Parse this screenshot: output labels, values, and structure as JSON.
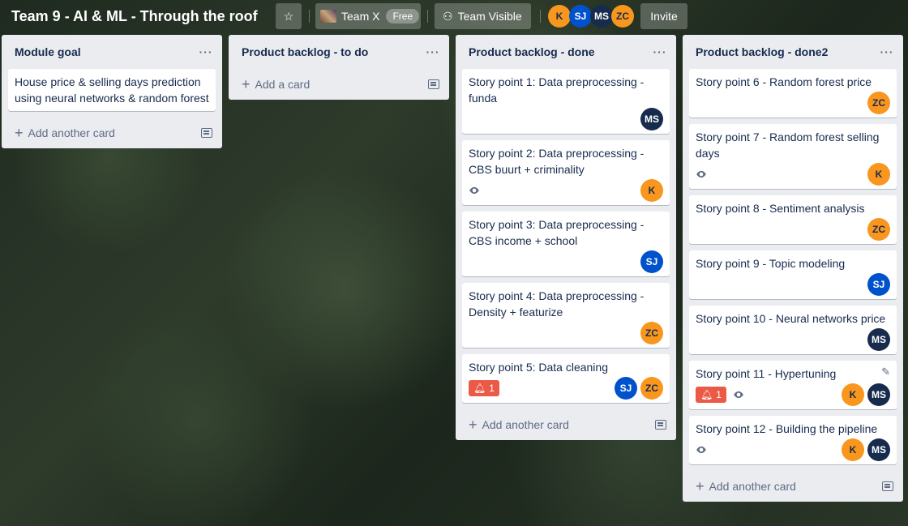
{
  "board": {
    "title": "Team 9 - AI & ML - Through the roof",
    "team_name": "Team X",
    "team_plan": "Free",
    "visibility": "Team Visible",
    "invite_label": "Invite",
    "members": [
      "K",
      "SJ",
      "MS",
      "ZC"
    ]
  },
  "lists": [
    {
      "title": "Module goal",
      "cards": [
        {
          "title": "House price & selling days prediction using neural networks & random forest"
        }
      ],
      "add_label": "Add another card"
    },
    {
      "title": "Product backlog - to do",
      "cards": [],
      "add_label": "Add a card"
    },
    {
      "title": "Product backlog - done",
      "cards": [
        {
          "title": "Story point 1: Data preprocessing - funda",
          "members": [
            "MS"
          ]
        },
        {
          "title": "Story point 2: Data preprocessing - CBS buurt + criminality",
          "members": [
            "K"
          ],
          "watched": true
        },
        {
          "title": "Story point 3: Data preprocessing - CBS income + school",
          "members": [
            "SJ"
          ]
        },
        {
          "title": "Story point 4: Data preprocessing - Density + featurize",
          "members": [
            "ZC"
          ]
        },
        {
          "title": "Story point 5: Data cleaning",
          "members": [
            "SJ",
            "ZC"
          ],
          "alert_count": "1"
        }
      ],
      "add_label": "Add another card"
    },
    {
      "title": "Product backlog - done2",
      "cards": [
        {
          "title": "Story point 6 - Random forest price",
          "members": [
            "ZC"
          ]
        },
        {
          "title": "Story point 7 - Random forest selling days",
          "members": [
            "K"
          ],
          "watched": true
        },
        {
          "title": "Story point 8 - Sentiment analysis",
          "members": [
            "ZC"
          ]
        },
        {
          "title": "Story point 9 - Topic modeling",
          "members": [
            "SJ"
          ]
        },
        {
          "title": "Story point 10 - Neural networks price",
          "members": [
            "MS"
          ]
        },
        {
          "title": "Story point 11 - Hypertuning",
          "members": [
            "K",
            "MS"
          ],
          "alert_count": "1",
          "watched": true
        },
        {
          "title": "Story point 12 - Building the pipeline",
          "members": [
            "K",
            "MS"
          ],
          "watched": true
        }
      ],
      "add_label": "Add another card"
    }
  ],
  "colors": {
    "K": "#f8961e",
    "ZC": "#f8961e",
    "SJ": "#0052cc",
    "MS": "#172b4d",
    "alert": "#eb5a46",
    "list_bg": "#ebecf0"
  },
  "icons": {
    "star": "star-icon",
    "visibility": "team-icon",
    "watch": "eye-icon",
    "alert": "bell-icon",
    "add": "plus-icon",
    "template": "card-template-icon",
    "menu": "ellipsis-icon"
  }
}
